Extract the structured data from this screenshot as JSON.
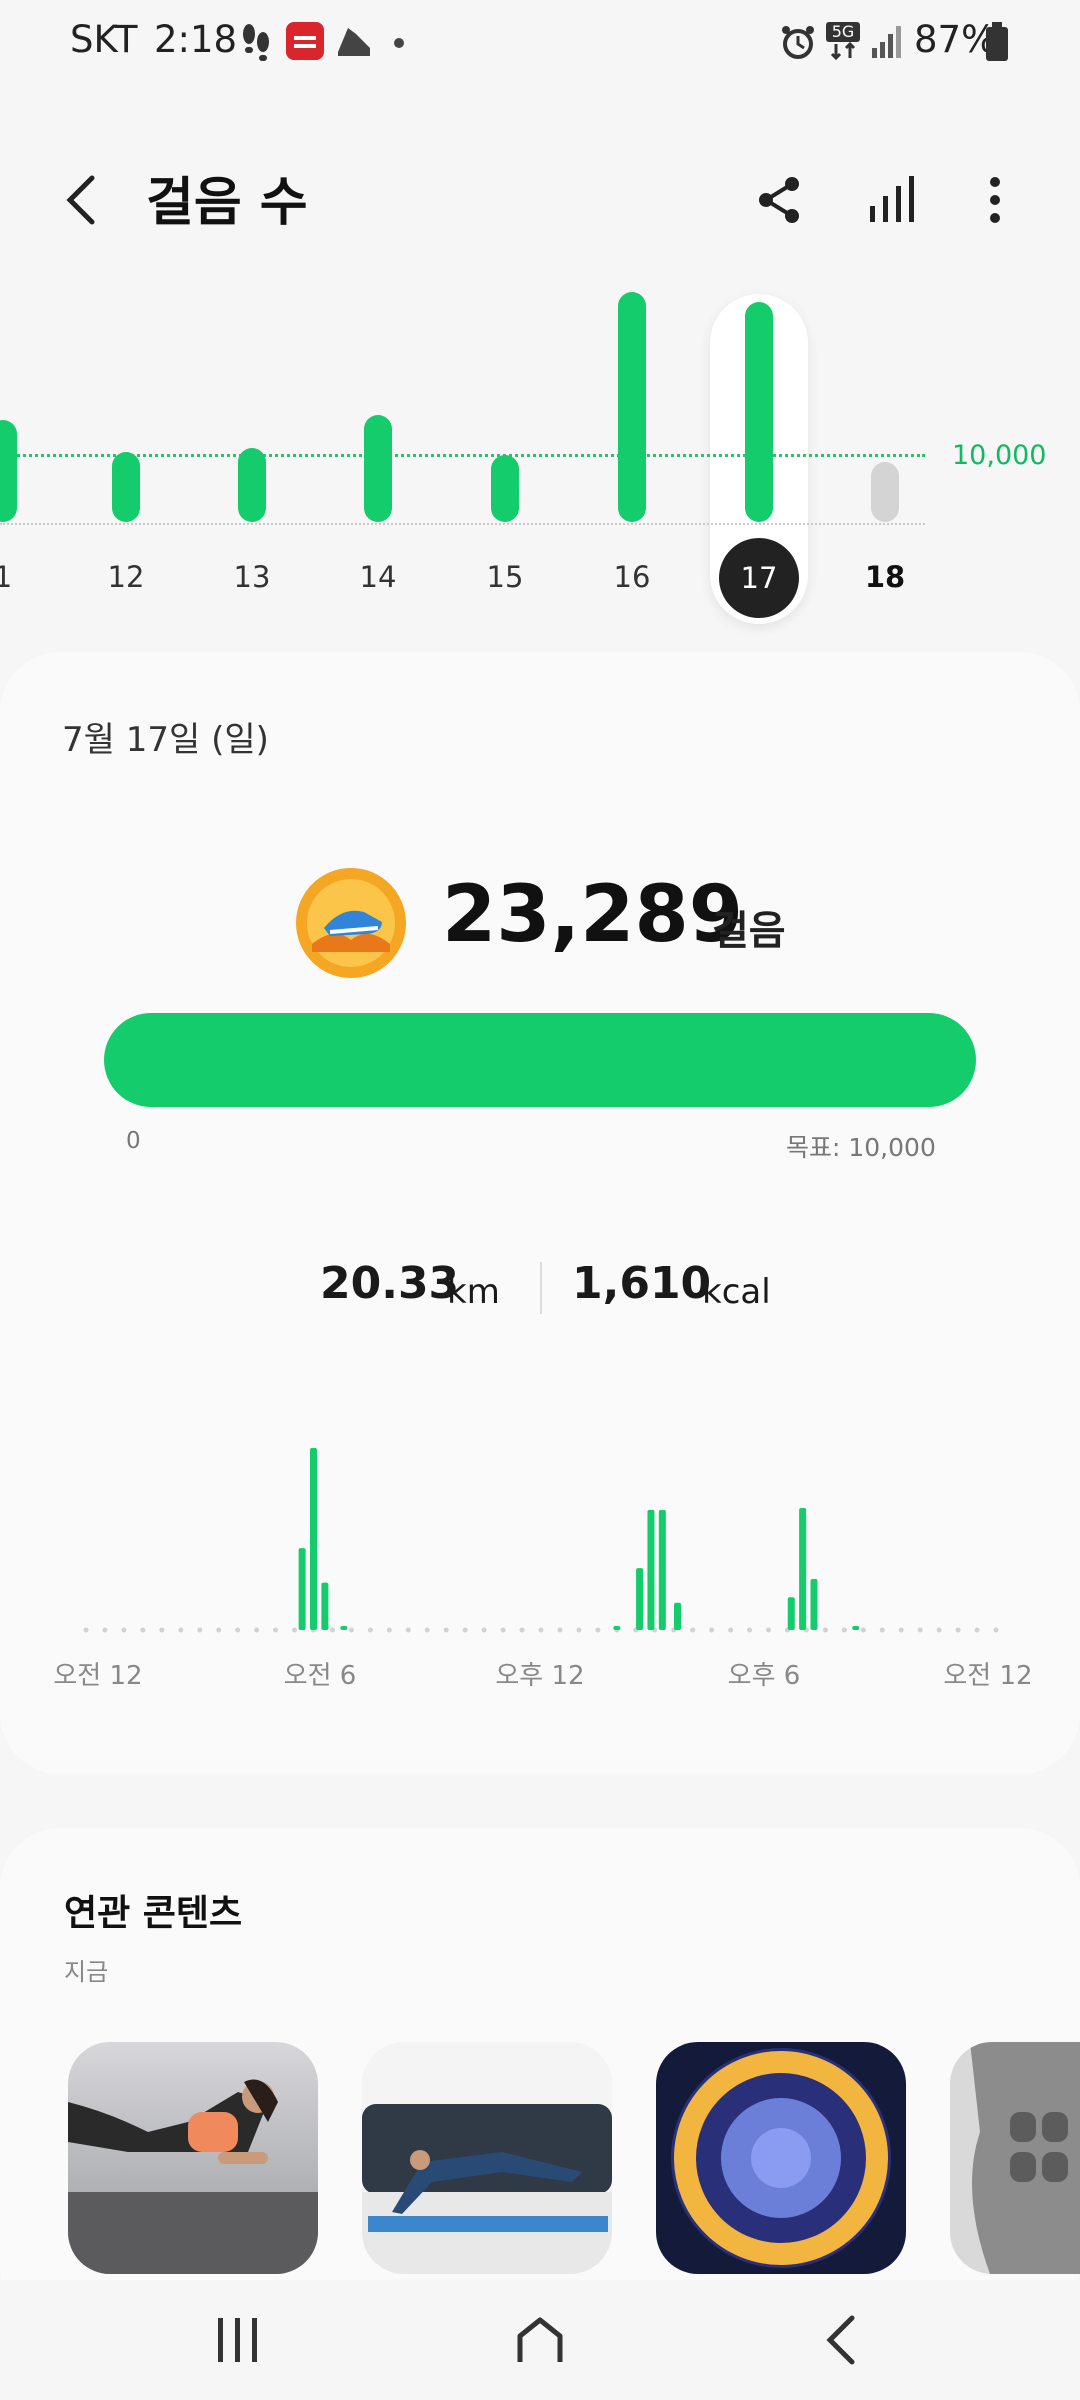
{
  "status_bar": {
    "carrier": "SKT",
    "time": "2:18",
    "battery": "87%",
    "network": "5G",
    "icons": [
      "footsteps-icon",
      "app-badge-icon",
      "shoe-icon",
      "dot-icon",
      "alarm-icon",
      "5g-icon",
      "signal-icon",
      "battery-icon"
    ]
  },
  "header": {
    "title": "걸음 수",
    "icons": [
      "back-icon",
      "share-icon",
      "bar-chart-icon",
      "more-icon"
    ]
  },
  "week_chart": {
    "goal_label": "10,000",
    "days": [
      {
        "label": "1",
        "steps": 10800
      },
      {
        "label": "12",
        "steps": 7400
      },
      {
        "label": "13",
        "steps": 7800
      },
      {
        "label": "14",
        "steps": 11300
      },
      {
        "label": "15",
        "steps": 7100
      },
      {
        "label": "16",
        "steps": 24400
      },
      {
        "label": "17",
        "steps": 23289,
        "selected": true
      },
      {
        "label": "18",
        "steps": 0,
        "today": true
      }
    ]
  },
  "summary": {
    "date": "7월 17일 (일)",
    "steps": "23,289",
    "steps_unit": "걸음",
    "progress_fraction": 1.0,
    "progress_min": "0",
    "goal_text": "목표: 10,000",
    "distance_value": "20.33",
    "distance_unit": "km",
    "calories_value": "1,610",
    "calories_unit": "kcal",
    "colors": {
      "accent": "#14cc6b",
      "badge": "#f5a623"
    }
  },
  "hourly_chart": {
    "x_labels": [
      "오전 12",
      "오전 6",
      "오후 12",
      "오후 6",
      "오전 12"
    ],
    "bars": [
      {
        "hour": 5.7,
        "steps": 0.45
      },
      {
        "hour": 6.0,
        "steps": 1.0
      },
      {
        "hour": 6.3,
        "steps": 0.26
      },
      {
        "hour": 6.8,
        "steps": 0.02
      },
      {
        "hour": 14.0,
        "steps": 0.02
      },
      {
        "hour": 14.6,
        "steps": 0.34
      },
      {
        "hour": 14.9,
        "steps": 0.66
      },
      {
        "hour": 15.2,
        "steps": 0.66
      },
      {
        "hour": 15.6,
        "steps": 0.15
      },
      {
        "hour": 18.6,
        "steps": 0.18
      },
      {
        "hour": 18.9,
        "steps": 0.67
      },
      {
        "hour": 19.2,
        "steps": 0.28
      },
      {
        "hour": 20.3,
        "steps": 0.02
      }
    ]
  },
  "related": {
    "title": "연관 콘텐츠",
    "subtitle": "지금",
    "items": [
      "plank-exercise-thumbnail",
      "yoga-pose-thumbnail",
      "city-night-globe-thumbnail",
      "abs-muscle-thumbnail"
    ]
  },
  "nav": {
    "icons": [
      "recent-apps-icon",
      "home-icon",
      "back-nav-icon"
    ]
  }
}
